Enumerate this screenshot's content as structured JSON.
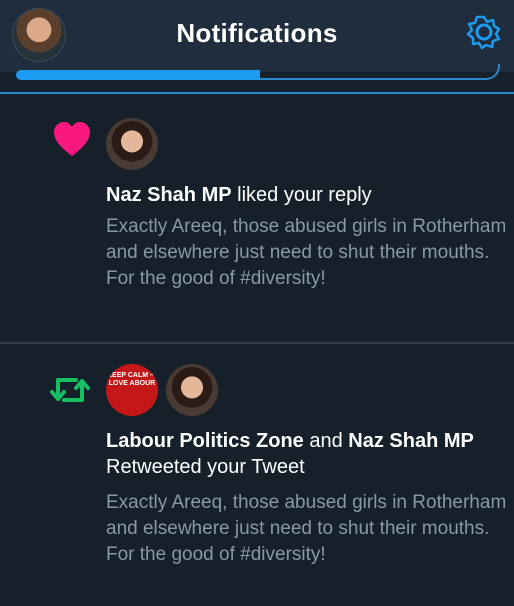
{
  "header": {
    "title": "Notifications",
    "settings_icon": "gear-icon",
    "avatar_icon": "profile-avatar"
  },
  "notifications": [
    {
      "type": "like",
      "icon": "heart-icon",
      "icon_color": "#f91880",
      "actors": [
        "Naz Shah MP"
      ],
      "action": "liked your reply",
      "text": "Exactly Areeq, those abused girls in Rotherham and elsewhere just need to shut their mouths. For the good of #diversity!"
    },
    {
      "type": "retweet",
      "icon": "retweet-icon",
      "icon_color": "#17bf63",
      "actors": [
        "Labour Politics Zone",
        "Naz Shah MP"
      ],
      "joiner": "and",
      "action": "Retweeted your Tweet",
      "actor_avatar_text": "KEEP CALM — LOVE ABOUR",
      "text": "Exactly Areeq, those abused girls in Rotherham and elsewhere just need to shut their mouths. For the good of #diversity!"
    }
  ],
  "colors": {
    "background": "#15202b",
    "header": "#1f2d3d",
    "accent": "#1d9bf0",
    "secondary_text": "#8899a6"
  }
}
